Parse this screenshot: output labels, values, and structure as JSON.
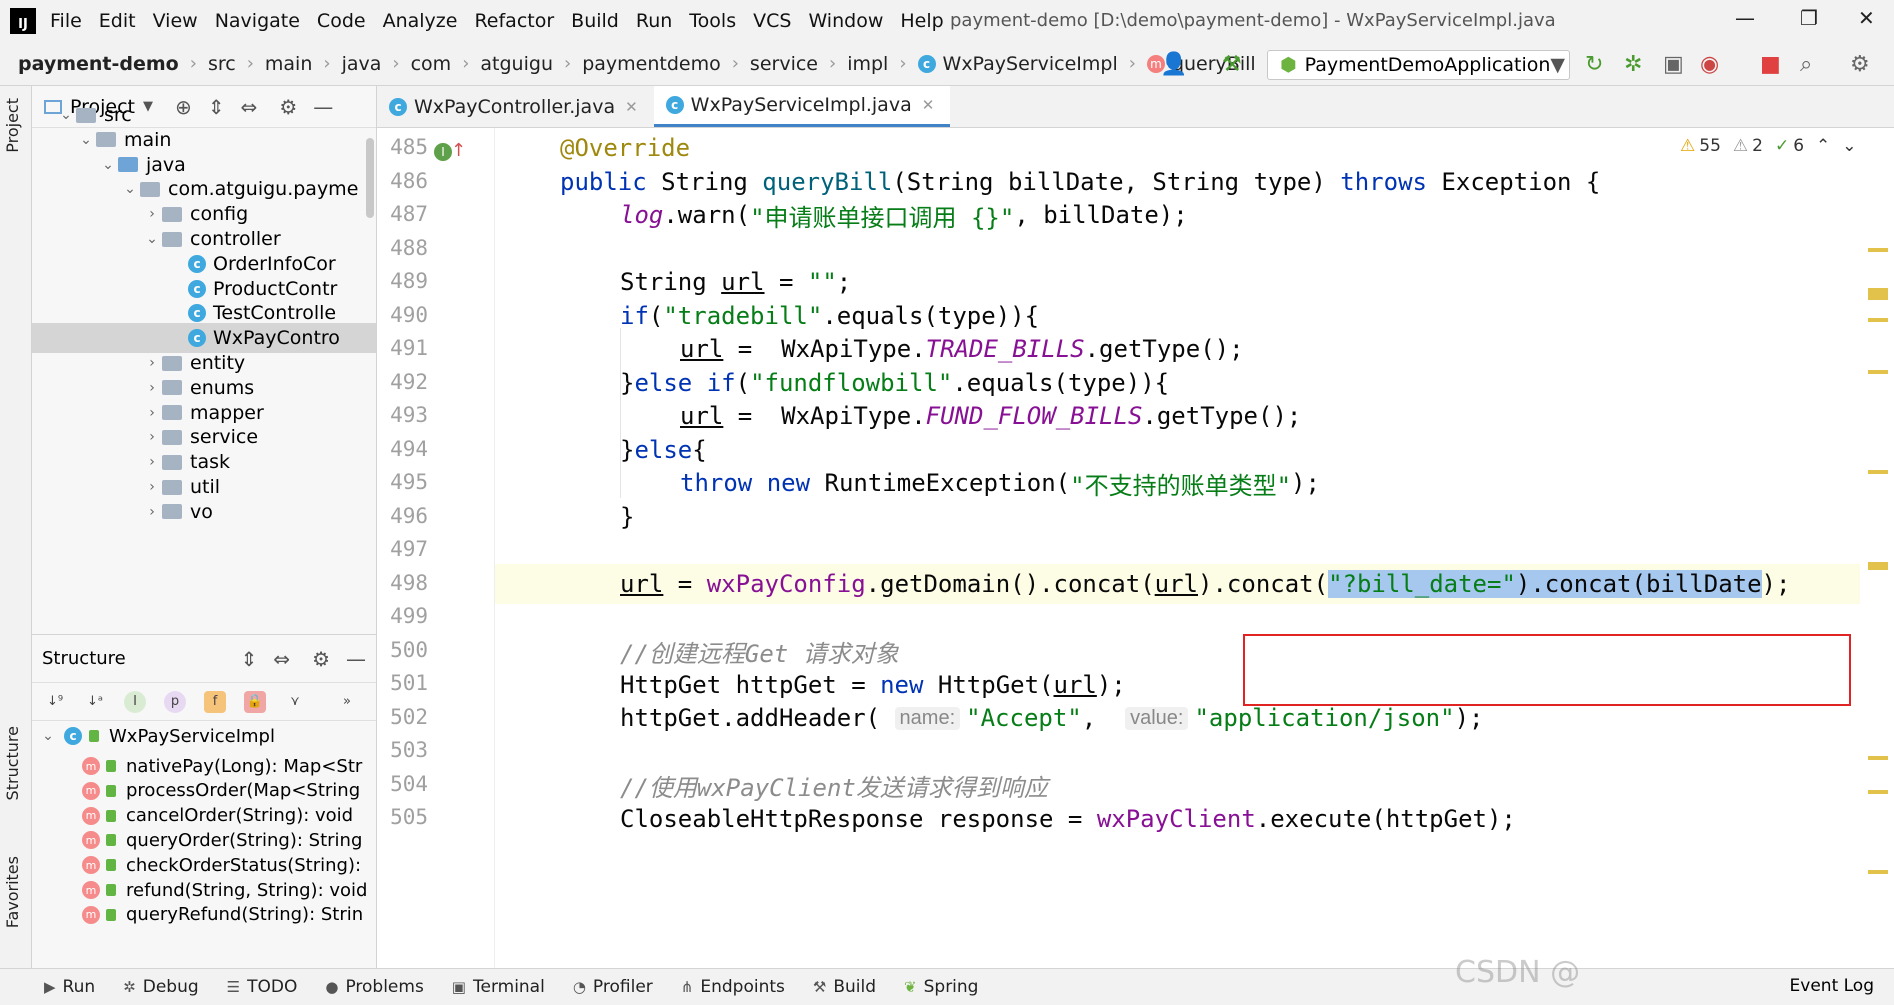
{
  "menu": {
    "items": [
      "File",
      "Edit",
      "View",
      "Navigate",
      "Code",
      "Analyze",
      "Refactor",
      "Build",
      "Run",
      "Tools",
      "VCS",
      "Window",
      "Help"
    ],
    "window_title": "payment-demo [D:\\demo\\payment-demo] - WxPayServiceImpl.java"
  },
  "navbar": {
    "crumbs": [
      "payment-demo",
      "src",
      "main",
      "java",
      "com",
      "atguigu",
      "paymentdemo",
      "service",
      "impl",
      "WxPayServiceImpl",
      "queryBill"
    ],
    "run_config": "PaymentDemoApplication"
  },
  "left_tabs": {
    "project": "Project",
    "structure": "Structure",
    "favorites": "Favorites"
  },
  "project": {
    "title": "Project",
    "tree": [
      {
        "label": "src",
        "kind": "folder",
        "depth": 1,
        "arrow": "open"
      },
      {
        "label": "main",
        "kind": "folder",
        "depth": 2,
        "arrow": "open"
      },
      {
        "label": "java",
        "kind": "folder-blue",
        "depth": 3,
        "arrow": "open"
      },
      {
        "label": "com.atguigu.payme",
        "kind": "package",
        "depth": 4,
        "arrow": "open"
      },
      {
        "label": "config",
        "kind": "package",
        "depth": 5,
        "arrow": "closed"
      },
      {
        "label": "controller",
        "kind": "package",
        "depth": 5,
        "arrow": "open"
      },
      {
        "label": "OrderInfoCor",
        "kind": "class",
        "depth": 6,
        "arrow": ""
      },
      {
        "label": "ProductContr",
        "kind": "class",
        "depth": 6,
        "arrow": ""
      },
      {
        "label": "TestControlle",
        "kind": "class",
        "depth": 6,
        "arrow": ""
      },
      {
        "label": "WxPayContro",
        "kind": "class",
        "depth": 6,
        "arrow": "",
        "selected": true
      },
      {
        "label": "entity",
        "kind": "package",
        "depth": 5,
        "arrow": "closed"
      },
      {
        "label": "enums",
        "kind": "package",
        "depth": 5,
        "arrow": "closed"
      },
      {
        "label": "mapper",
        "kind": "package",
        "depth": 5,
        "arrow": "closed"
      },
      {
        "label": "service",
        "kind": "package",
        "depth": 5,
        "arrow": "closed"
      },
      {
        "label": "task",
        "kind": "package",
        "depth": 5,
        "arrow": "closed"
      },
      {
        "label": "util",
        "kind": "package",
        "depth": 5,
        "arrow": "closed"
      },
      {
        "label": "vo",
        "kind": "package",
        "depth": 5,
        "arrow": "closed"
      }
    ]
  },
  "structure": {
    "title": "Structure",
    "class_name": "WxPayServiceImpl",
    "methods": [
      "nativePay(Long): Map<Str",
      "processOrder(Map<String",
      "cancelOrder(String): void",
      "queryOrder(String): String",
      "checkOrderStatus(String):",
      "refund(String, String): void",
      "queryRefund(String): Strin"
    ]
  },
  "tabs": [
    {
      "label": "WxPayController.java",
      "active": false
    },
    {
      "label": "WxPayServiceImpl.java",
      "active": true
    }
  ],
  "inspection": {
    "warnings": "55",
    "weak_warnings": "2",
    "typos": "6"
  },
  "code": {
    "line_numbers": [
      "485",
      "486",
      "487",
      "488",
      "489",
      "490",
      "491",
      "492",
      "493",
      "494",
      "495",
      "496",
      "497",
      "498",
      "499",
      "500",
      "501",
      "502",
      "503",
      "504",
      "505"
    ],
    "lines": [
      "@Override",
      "public String queryBill(String billDate, String type) throws Exception {",
      "log.warn(\"申请账单接口调用 {}\", billDate);",
      "",
      "String url = \"\";",
      "if(\"tradebill\".equals(type)){",
      "url =  WxApiType.TRADE_BILLS.getType();",
      "}else if(\"fundflowbill\".equals(type)){",
      "url =  WxApiType.FUND_FLOW_BILLS.getType();",
      "}else{",
      "throw new RuntimeException(\"不支持的账单类型\");",
      "}",
      "",
      "url = wxPayConfig.getDomain().concat(url).concat(\"?bill_date=\").concat(billDate);",
      "",
      "//创建远程Get 请求对象",
      "HttpGet httpGet = new HttpGet(url);",
      "httpGet.addHeader( name: \"Accept\",  value: \"application/json\");",
      "",
      "//使用wxPayClient发送请求得到响应",
      "CloseableHttpResponse response = wxPayClient.execute(httpGet);"
    ],
    "hint_name": "name:",
    "hint_value": "value:"
  },
  "bottombar": {
    "items": [
      "Run",
      "Debug",
      "TODO",
      "Problems",
      "Terminal",
      "Profiler",
      "Endpoints",
      "Build",
      "Spring"
    ],
    "event_log": "Event Log"
  },
  "watermark": "CSDN @",
  "colors": {
    "accent": "#4083c9",
    "keyword": "#0033b3",
    "string": "#067d17",
    "field": "#871094",
    "annotation": "#9e880d",
    "highlight_box": "#e02424"
  }
}
